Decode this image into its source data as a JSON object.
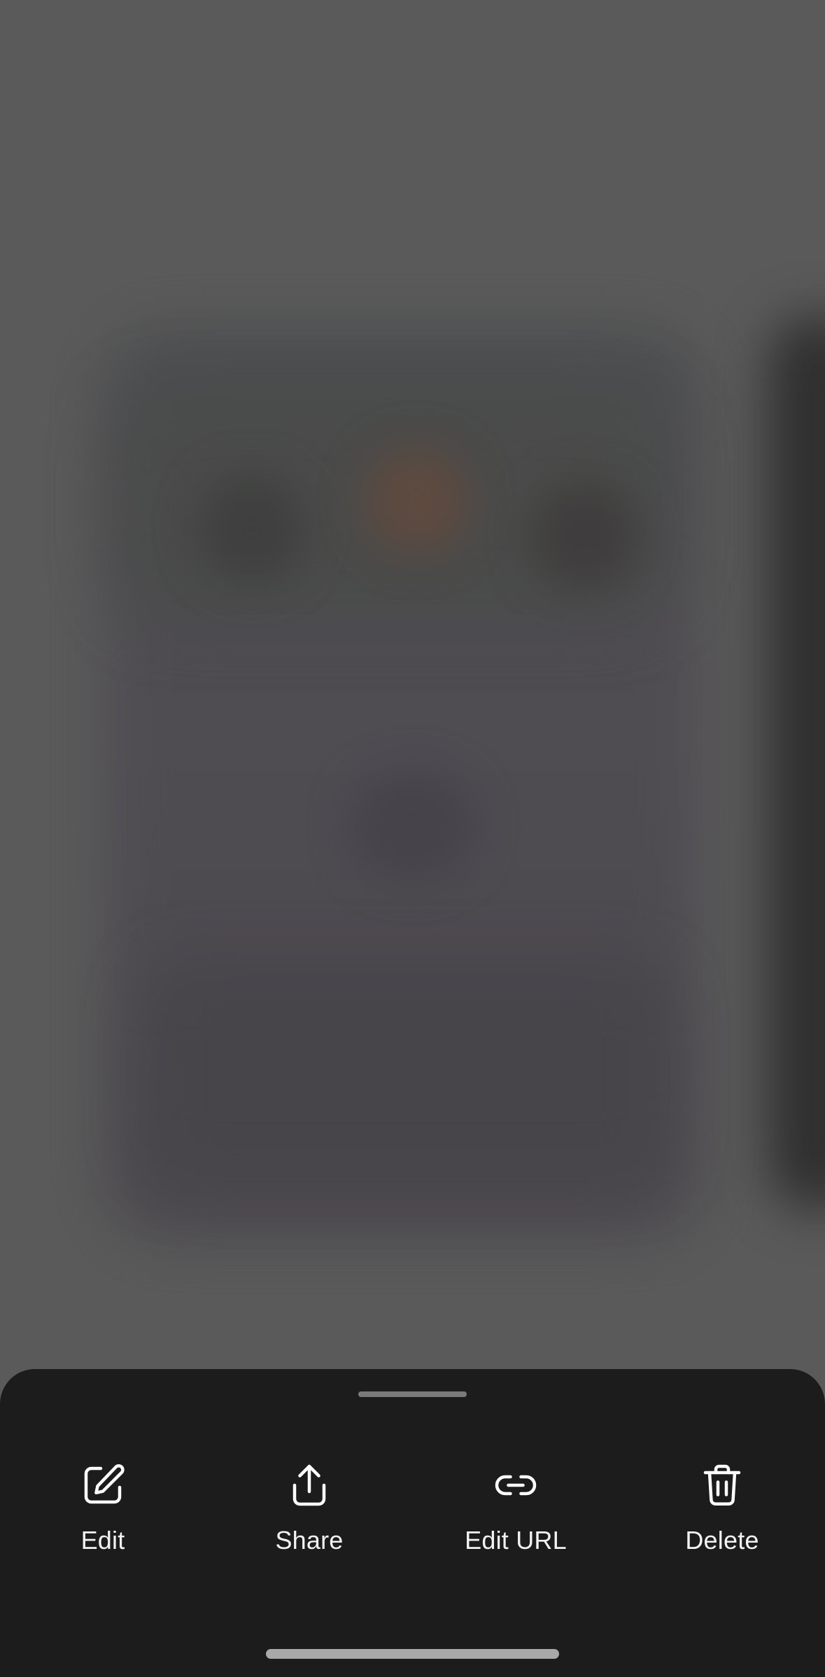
{
  "sheet": {
    "actions": [
      {
        "label": "Edit",
        "icon": "edit-icon"
      },
      {
        "label": "Share",
        "icon": "share-icon"
      },
      {
        "label": "Edit URL",
        "icon": "link-icon"
      },
      {
        "label": "Delete",
        "icon": "trash-icon"
      }
    ]
  },
  "colors": {
    "sheet_background": "#1c1c1c",
    "backdrop": "#5a5a5a",
    "label": "#f2f2f2",
    "icon_stroke": "#ffffff",
    "grabber": "#7a7a7a",
    "home_indicator": "#a9a9a9"
  }
}
